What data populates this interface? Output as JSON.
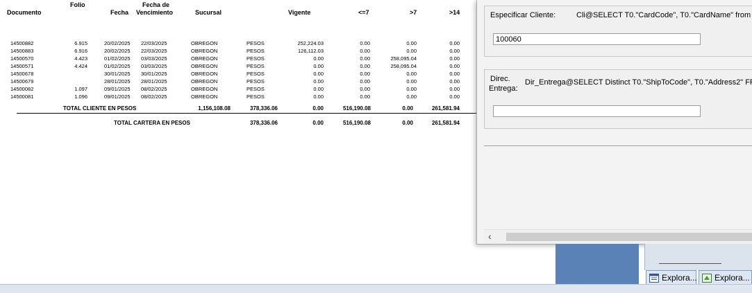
{
  "report": {
    "headers": {
      "documento": "Documento",
      "folio": "Folio",
      "fecha": "Fecha",
      "fecha_de": "Fecha de",
      "vencimiento": "Vencimiento",
      "sucursal": "Sucursal",
      "vigente": "Vigente",
      "le7": "<=7",
      "gt7": ">7",
      "gt14": ">14"
    },
    "rows": [
      {
        "doc": "14500882",
        "folio": "6.915",
        "fecha": "20/02/2025",
        "venc": "22/03/2025",
        "sucursal": "OBREGON",
        "moneda": "PESOS",
        "saldo": "252,224.03",
        "le7": "0.00",
        "gt7": "0.00",
        "gt14": "0.00"
      },
      {
        "doc": "14500883",
        "folio": "6.916",
        "fecha": "20/02/2025",
        "venc": "22/03/2025",
        "sucursal": "OBREGON",
        "moneda": "PESOS",
        "saldo": "126,112.03",
        "le7": "0.00",
        "gt7": "0.00",
        "gt14": "0.00"
      },
      {
        "doc": "14500570",
        "folio": "4.423",
        "fecha": "01/02/2025",
        "venc": "03/03/2025",
        "sucursal": "OBREGON",
        "moneda": "PESOS",
        "saldo": "0.00",
        "le7": "0.00",
        "gt7": "258,095.04",
        "gt14": "0.00"
      },
      {
        "doc": "14500571",
        "folio": "4.424",
        "fecha": "01/02/2025",
        "venc": "03/03/2025",
        "sucursal": "OBREGON",
        "moneda": "PESOS",
        "saldo": "0.00",
        "le7": "0.00",
        "gt7": "258,095.04",
        "gt14": "0.00"
      },
      {
        "doc": "14500678",
        "folio": "",
        "fecha": "30/01/2025",
        "venc": "30/01/2025",
        "sucursal": "OBREGON",
        "moneda": "PESOS",
        "saldo": "0.00",
        "le7": "0.00",
        "gt7": "0.00",
        "gt14": "0.00"
      },
      {
        "doc": "14500679",
        "folio": "",
        "fecha": "28/01/2025",
        "venc": "28/01/2025",
        "sucursal": "OBREGON",
        "moneda": "PESOS",
        "saldo": "0.00",
        "le7": "0.00",
        "gt7": "0.00",
        "gt14": "0.00"
      },
      {
        "doc": "14500082",
        "folio": "1.097",
        "fecha": "09/01/2025",
        "venc": "08/02/2025",
        "sucursal": "OBREGON",
        "moneda": "PESOS",
        "saldo": "0.00",
        "le7": "0.00",
        "gt7": "0.00",
        "gt14": "0.00"
      },
      {
        "doc": "14500081",
        "folio": "1.096",
        "fecha": "09/01/2025",
        "venc": "08/02/2025",
        "sucursal": "OBREGON",
        "moneda": "PESOS",
        "saldo": "0.00",
        "le7": "0.00",
        "gt7": "0.00",
        "gt14": "0.00"
      }
    ],
    "total_cliente": {
      "label": "TOTAL CLIENTE EN PESOS",
      "total": "1,156,108.08",
      "vigente": "378,336.06",
      "le7": "0.00",
      "gt7": "516,190.08",
      "c5": "0.00",
      "c6": "261,581.94"
    },
    "total_cartera": {
      "label": "TOTAL CARTERA EN PESOS",
      "vigente": "378,336.06",
      "le7": "0.00",
      "gt7": "516,190.08",
      "c5": "0.00",
      "c6": "261,581.94"
    }
  },
  "dialog": {
    "cliente_label": "Especificar Cliente:",
    "cliente_query": "Cli@SELECT T0.\"CardCode\", T0.\"CardName\" from OC",
    "cliente_value": "100060",
    "entrega_label_1": "Direc.",
    "entrega_label_2": "Entrega:",
    "entrega_query": "Dir_Entrega@SELECT Distinct T0.\"ShipToCode\", T0.\"Address2\" FROM",
    "entrega_value": ""
  },
  "taskbar": {
    "btn1": "Explora...",
    "btn2": "Explora..."
  }
}
